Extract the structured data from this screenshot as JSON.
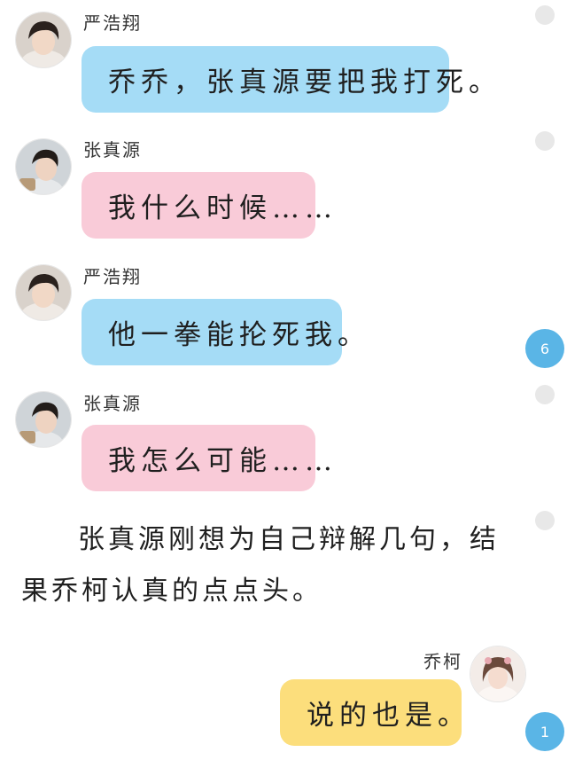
{
  "messages": [
    {
      "speaker": "严浩翔",
      "text": "乔乔，张真源要把我打死。"
    },
    {
      "speaker": "张真源",
      "text": "我什么时候……"
    },
    {
      "speaker": "严浩翔",
      "text": "他一拳能抡死我。"
    },
    {
      "speaker": "张真源",
      "text": "我怎么可能……"
    }
  ],
  "narration": "张真源刚想为自己辩解几句，结果乔柯认真的点点头。",
  "reply": {
    "speaker": "乔柯",
    "text": "说的也是。"
  },
  "badges": {
    "first": "6",
    "second": "1"
  },
  "colors": {
    "blue_bubble": "#a5dcf6",
    "pink_bubble": "#f9cbd8",
    "yellow_bubble": "#fcde7c",
    "badge": "#5ab5e6"
  }
}
